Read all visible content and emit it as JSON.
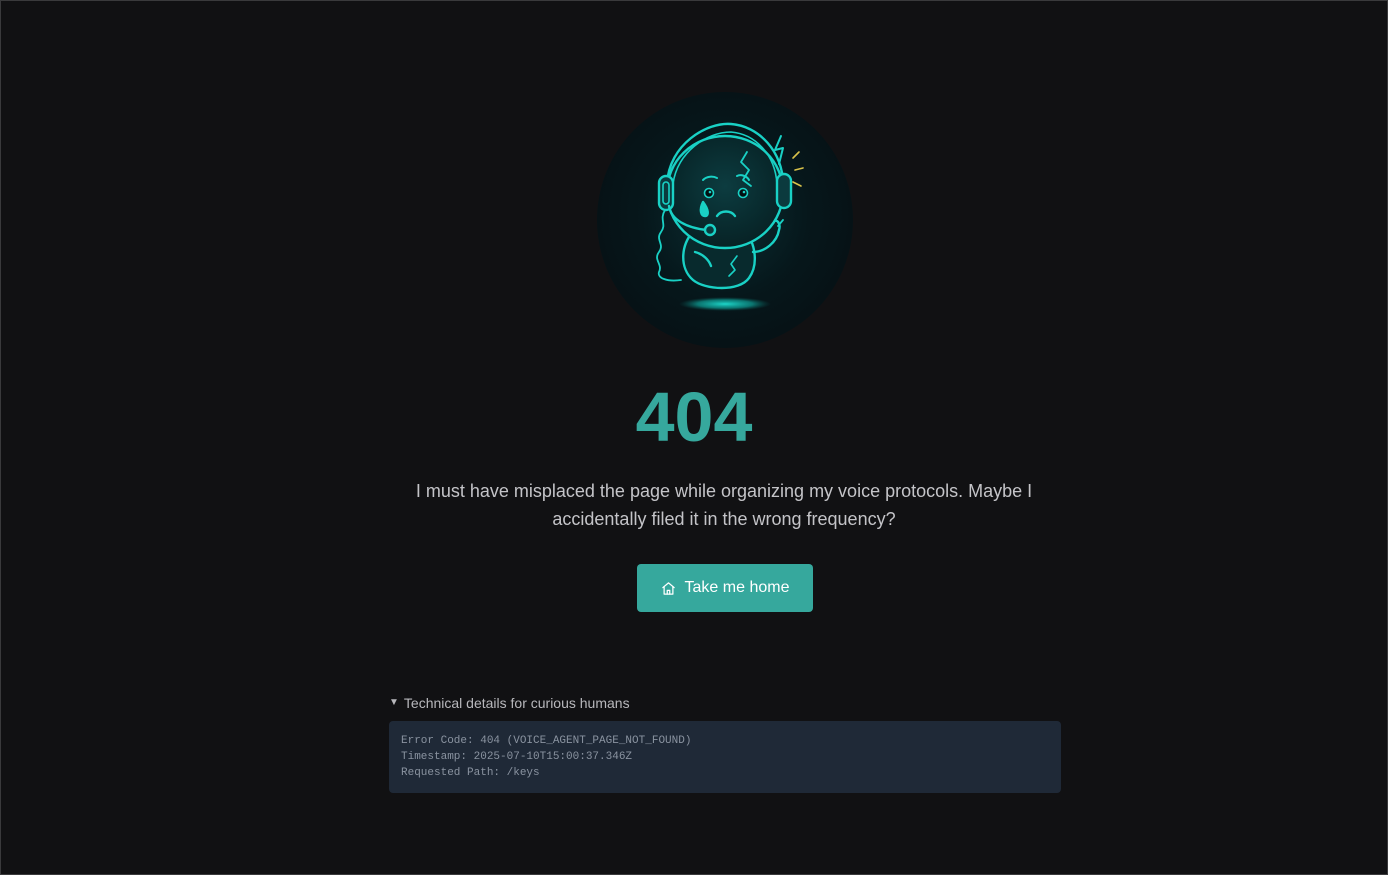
{
  "illustration": {
    "icon": "sad-headset-robot-icon",
    "accent_color": "#19d1c5"
  },
  "error": {
    "code": "404",
    "message": "I must have misplaced the page while organizing my voice protocols. Maybe I accidentally filed it in the wrong frequency?"
  },
  "home_button": {
    "label": "Take me home",
    "icon": "home-icon",
    "color": "#36a89d"
  },
  "details": {
    "summary": "Technical details for curious humans",
    "lines": [
      "Error Code: 404 (VOICE_AGENT_PAGE_NOT_FOUND)",
      "Timestamp: 2025-07-10T15:00:37.346Z",
      "Requested Path: /keys"
    ]
  }
}
